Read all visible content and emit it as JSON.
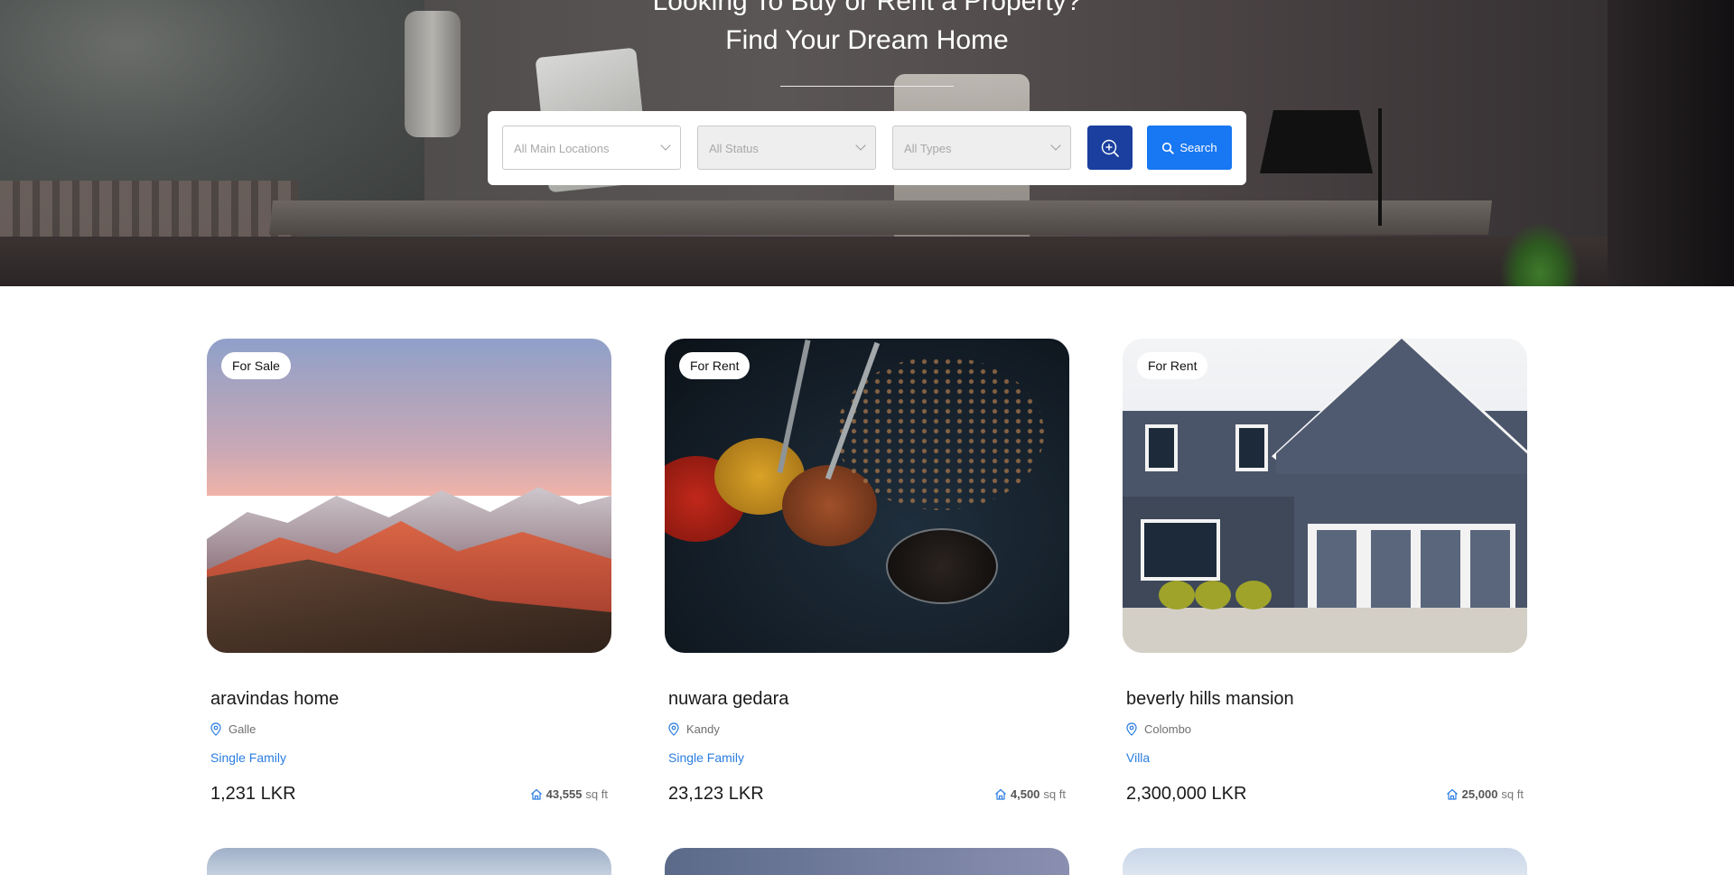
{
  "hero": {
    "title_line1": "Looking To Buy or Rent a Property?",
    "title_line2": "Find Your Dream Home"
  },
  "search": {
    "location_placeholder": "All Main Locations",
    "status_placeholder": "All Status",
    "type_placeholder": "All Types",
    "advanced_icon": "zoom-in-icon",
    "search_label": "Search",
    "search_icon": "search-icon",
    "accent": "#1877f2",
    "advanced_color": "#1a3f9e"
  },
  "listings": [
    {
      "badge": "For Sale",
      "title": "aravindas home",
      "location": "Galle",
      "type": "Single Family",
      "price": "1,231 LKR",
      "area_value": "43,555",
      "area_unit": "sq ft"
    },
    {
      "badge": "For Rent",
      "title": "nuwara gedara",
      "location": "Kandy",
      "type": "Single Family",
      "price": "23,123 LKR",
      "area_value": "4,500",
      "area_unit": "sq ft"
    },
    {
      "badge": "For Rent",
      "title": "beverly hills mansion",
      "location": "Colombo",
      "type": "Villa",
      "price": "2,300,000 LKR",
      "area_value": "25,000",
      "area_unit": "sq ft"
    }
  ],
  "colors": {
    "link_blue": "#2a7de1"
  }
}
